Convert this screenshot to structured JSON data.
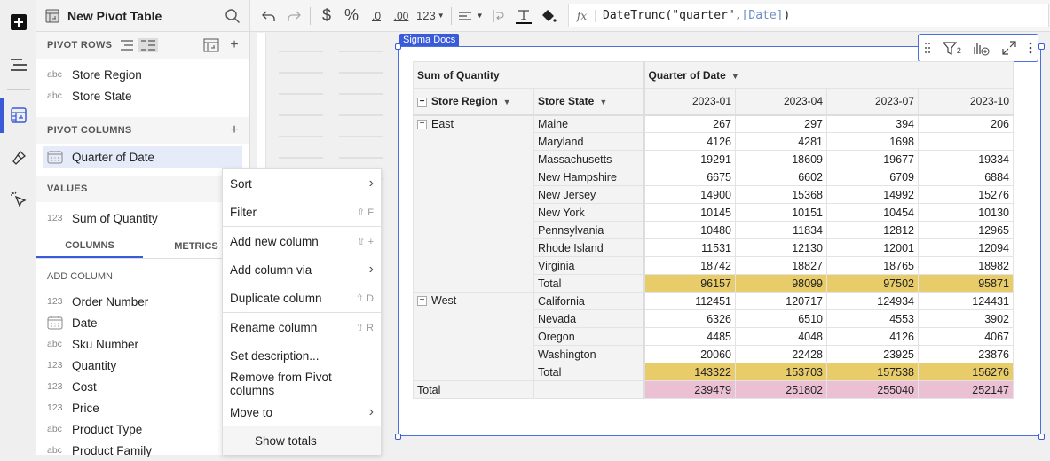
{
  "rail": {
    "items": [
      "add",
      "outline",
      "element-panel",
      "format",
      "actions"
    ]
  },
  "panel": {
    "title": "New Pivot Table",
    "pivot_rows_label": "PIVOT ROWS",
    "pivot_rows": [
      {
        "type": "abc",
        "name": "Store Region"
      },
      {
        "type": "abc",
        "name": "Store State"
      }
    ],
    "pivot_columns_label": "PIVOT COLUMNS",
    "pivot_columns": [
      {
        "type": "date",
        "name": "Quarter of Date"
      }
    ],
    "values_label": "VALUES",
    "values": [
      {
        "type": "123",
        "name": "Sum of Quantity"
      }
    ],
    "tabs": [
      "COLUMNS",
      "METRICS"
    ],
    "add_column_label": "ADD COLUMN",
    "add_columns": [
      {
        "type": "123",
        "name": "Order Number"
      },
      {
        "type": "date",
        "name": "Date"
      },
      {
        "type": "abc",
        "name": "Sku Number"
      },
      {
        "type": "123",
        "name": "Quantity"
      },
      {
        "type": "123",
        "name": "Cost"
      },
      {
        "type": "123",
        "name": "Price"
      },
      {
        "type": "abc",
        "name": "Product Type"
      },
      {
        "type": "abc",
        "name": "Product Family"
      }
    ]
  },
  "toolbar": {
    "number_format": "123",
    "currency": "$",
    "percent": "%",
    "dec_less": ".0",
    "dec_more": ".00"
  },
  "formula": {
    "fx": "fx",
    "text": "DateTrunc(\"quarter\", ",
    "ref": "[Date]",
    "close": ")"
  },
  "element": {
    "tag": "Sigma Docs",
    "filter_count": "2"
  },
  "pivot": {
    "corner": "Sum of Quantity",
    "col_header": "Quarter of Date",
    "row_headers": [
      "Store Region",
      "Store State"
    ],
    "quarters": [
      "2023-01",
      "2023-04",
      "2023-07",
      "2023-10"
    ],
    "groups": [
      {
        "region": "East",
        "rows": [
          {
            "state": "Maine",
            "v": [
              "267",
              "297",
              "394",
              "206"
            ]
          },
          {
            "state": "Maryland",
            "v": [
              "4126",
              "4281",
              "1698",
              ""
            ]
          },
          {
            "state": "Massachusetts",
            "v": [
              "19291",
              "18609",
              "19677",
              "19334"
            ]
          },
          {
            "state": "New Hampshire",
            "v": [
              "6675",
              "6602",
              "6709",
              "6884"
            ]
          },
          {
            "state": "New Jersey",
            "v": [
              "14900",
              "15368",
              "14992",
              "15276"
            ]
          },
          {
            "state": "New York",
            "v": [
              "10145",
              "10151",
              "10454",
              "10130"
            ]
          },
          {
            "state": "Pennsylvania",
            "v": [
              "10480",
              "11834",
              "12812",
              "12965"
            ]
          },
          {
            "state": "Rhode Island",
            "v": [
              "11531",
              "12130",
              "12001",
              "12094"
            ]
          },
          {
            "state": "Virginia",
            "v": [
              "18742",
              "18827",
              "18765",
              "18982"
            ]
          }
        ],
        "total_label": "Total",
        "total": [
          "96157",
          "98099",
          "97502",
          "95871"
        ]
      },
      {
        "region": "West",
        "rows": [
          {
            "state": "California",
            "v": [
              "112451",
              "120717",
              "124934",
              "124431"
            ]
          },
          {
            "state": "Nevada",
            "v": [
              "6326",
              "6510",
              "4553",
              "3902"
            ]
          },
          {
            "state": "Oregon",
            "v": [
              "4485",
              "4048",
              "4126",
              "4067"
            ]
          },
          {
            "state": "Washington",
            "v": [
              "20060",
              "22428",
              "23925",
              "23876"
            ]
          }
        ],
        "total_label": "Total",
        "total": [
          "143322",
          "153703",
          "157538",
          "156276"
        ]
      }
    ],
    "grand_total_label": "Total",
    "grand_total": [
      "239479",
      "251802",
      "255040",
      "252147"
    ],
    "colors": {
      "subtotal": "#e8cc6a",
      "grand_total": "#ebc0d3"
    }
  },
  "menu": [
    {
      "label": "Sort",
      "key": "›"
    },
    {
      "label": "Filter",
      "key": "⇧ F"
    },
    {
      "sep": true
    },
    {
      "label": "Add new column",
      "key": "⇧ +"
    },
    {
      "label": "Add column via",
      "key": "›"
    },
    {
      "label": "Duplicate column",
      "key": "⇧ D"
    },
    {
      "sep": true
    },
    {
      "label": "Rename column",
      "key": "⇧ R"
    },
    {
      "label": "Set description...",
      "key": ""
    },
    {
      "label": "Remove from Pivot columns",
      "key": ""
    },
    {
      "label": "Move to",
      "key": "›"
    },
    {
      "label": "Show totals",
      "key": "",
      "hover": true
    }
  ]
}
